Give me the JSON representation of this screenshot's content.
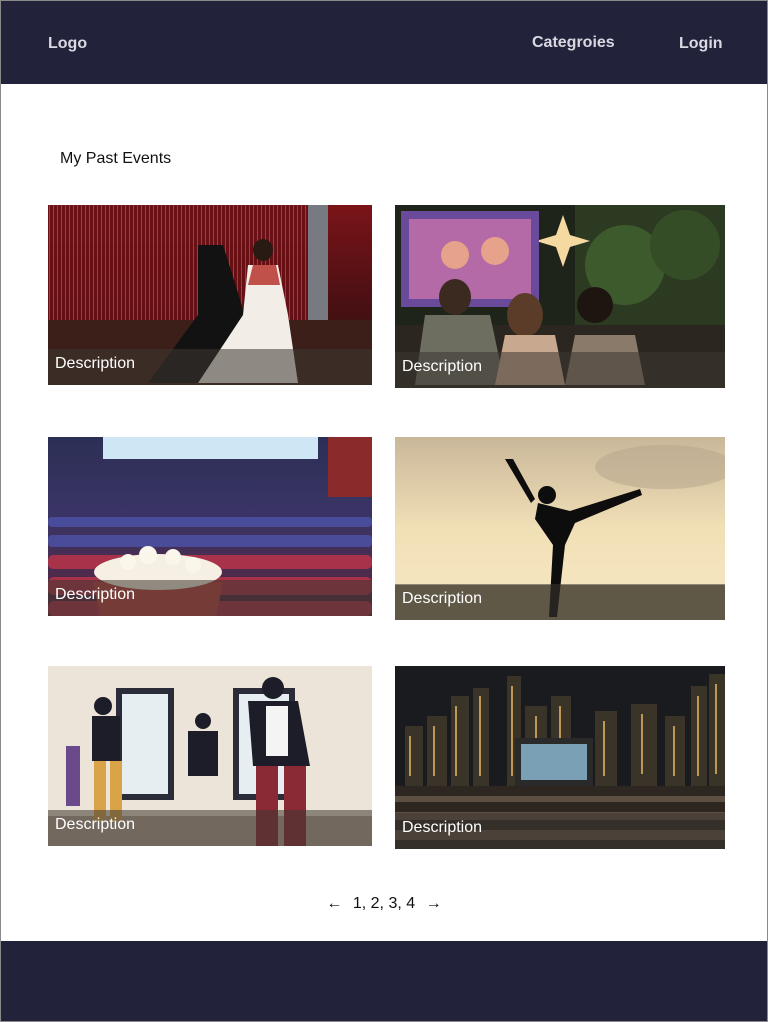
{
  "header": {
    "logo": "Logo",
    "nav": {
      "categories": "Categroies",
      "login": "Login"
    }
  },
  "main": {
    "title": "My Past Events",
    "cards": [
      {
        "caption": "Description",
        "icon": "ballroom-dance-photo"
      },
      {
        "caption": "Description",
        "icon": "outdoor-movie-photo"
      },
      {
        "caption": "Description",
        "icon": "cinema-popcorn-photo"
      },
      {
        "caption": "Description",
        "icon": "ballet-silhouette-photo"
      },
      {
        "caption": "Description",
        "icon": "hiphop-dance-photo"
      },
      {
        "caption": "Description",
        "icon": "city-movie-night-photo"
      }
    ]
  },
  "pagination": {
    "pages": "1, 2, 3, 4",
    "prev": "←",
    "next": "→"
  },
  "colors": {
    "header_bg": "#22223b",
    "footer_bg": "#22223b",
    "nav_text": "#d9d9e3"
  }
}
